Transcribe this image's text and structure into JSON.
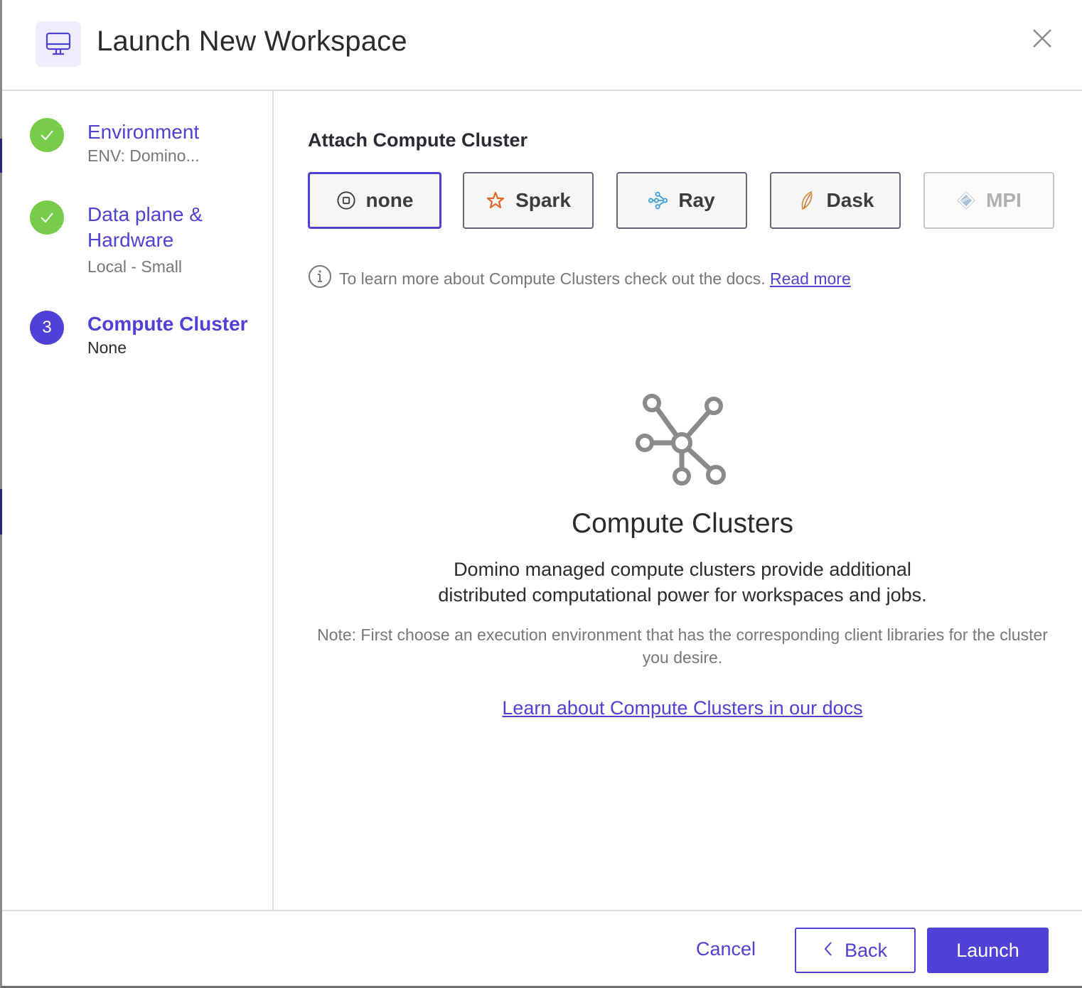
{
  "header": {
    "icon": "monitor-icon",
    "title": "Launch New Workspace",
    "close_icon": "close-icon"
  },
  "steps": [
    {
      "number": "1",
      "status": "complete",
      "title": "Environment",
      "subtitle": "ENV: Domino...",
      "icon": "check-icon"
    },
    {
      "number": "2",
      "status": "complete",
      "title": "Data plane & Hardware",
      "subtitle": "Local - Small",
      "icon": "check-icon"
    },
    {
      "number": "3",
      "status": "active",
      "title": "Compute Cluster",
      "subtitle": "None"
    }
  ],
  "main": {
    "section_title": "Attach Compute Cluster",
    "cluster_options": [
      {
        "label": "none",
        "icon": "stop-circle-icon",
        "state": "selected"
      },
      {
        "label": "Spark",
        "icon": "spark-star-icon",
        "state": "default"
      },
      {
        "label": "Ray",
        "icon": "ray-nodes-icon",
        "state": "default"
      },
      {
        "label": "Dask",
        "icon": "dask-leaf-icon",
        "state": "default"
      },
      {
        "label": "MPI",
        "icon": "mpi-diamond-icon",
        "state": "disabled"
      }
    ],
    "info_text": "To learn more about Compute Clusters check out the docs.",
    "info_link": "Read more",
    "empty_state": {
      "icon": "cluster-network-icon",
      "title": "Compute Clusters",
      "description": "Domino managed compute clusters provide additional distributed computational power for workspaces and jobs.",
      "note": "Note: First choose an execution environment that has the corresponding client libraries for the cluster you desire.",
      "link": "Learn about Compute Clusters in our docs"
    }
  },
  "footer": {
    "cancel_label": "Cancel",
    "back_label": "Back",
    "launch_label": "Launch"
  },
  "colors": {
    "accent": "#4f41d6",
    "success": "#77cc4a",
    "spark": "#e0662c",
    "ray": "#3a9de0",
    "dask": "#d98a3c"
  }
}
